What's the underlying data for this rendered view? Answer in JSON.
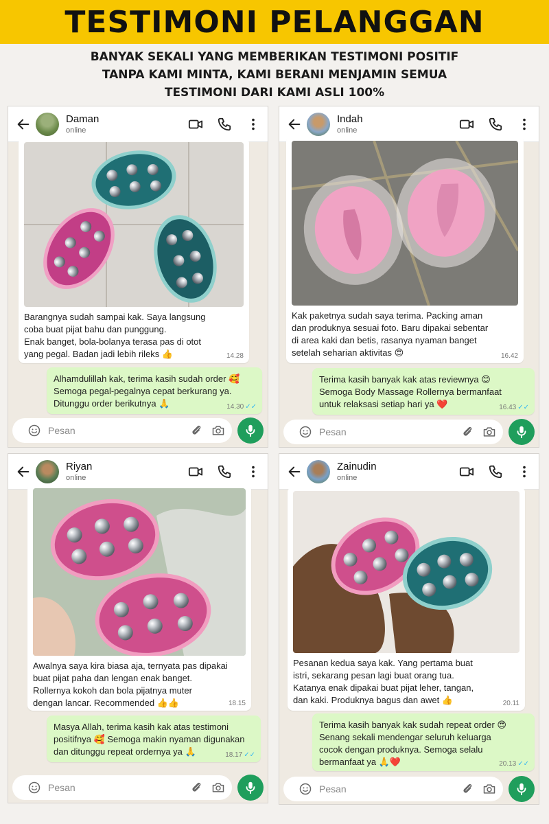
{
  "banner": {
    "title": "TESTIMONI PELANGGAN"
  },
  "subtitle": {
    "line1": "BANYAK SEKALI YANG MEMBERIKAN TESTIMONI POSITIF",
    "line2": "TANPA KAMI MINTA, KAMI BERANI MENJAMIN SEMUA",
    "line3": "TESTIMONI DARI KAMI ASLI 100%"
  },
  "colors": {
    "banner": "#f7c600",
    "outgoing_bubble": "#dcf8c6",
    "chat_bg": "#efeae2",
    "mic_button": "#1f9e5c",
    "read_ticks": "#34b7f1"
  },
  "icons": {
    "back": "arrow-left-icon",
    "video": "video-call-icon",
    "call": "phone-icon",
    "menu": "more-vert-icon",
    "emoji": "emoji-icon",
    "attach": "paperclip-icon",
    "camera": "camera-icon",
    "mic": "mic-icon"
  },
  "composer_placeholder": "Pesan",
  "chats": [
    {
      "name": "Daman",
      "status": "online",
      "incoming": {
        "line1": "Barangnya sudah sampai kak. Saya langsung",
        "line2": "coba buat pijat bahu dan punggung.",
        "line3": "Enak banget, bola-bolanya terasa pas di otot",
        "line4": "yang pegal. Badan jadi lebih rileks 👍",
        "time": "14.28"
      },
      "reply": {
        "line1": "Alhamdulillah kak, terima kasih sudah order 🥰",
        "line2": "Semoga pegal-pegalnya cepat berkurang ya.",
        "line3": "Ditunggu order berikutnya 🙏",
        "time": "14.30"
      }
    },
    {
      "name": "Indah",
      "status": "online",
      "incoming": {
        "line1": "Kak paketnya sudah saya terima. Packing aman",
        "line2": "dan produknya sesuai foto. Baru dipakai sebentar",
        "line3": "di area kaki dan betis, rasanya nyaman banget",
        "line4": "setelah seharian aktivitas 😍",
        "time": "16.42"
      },
      "reply": {
        "line1": "Terima kasih banyak kak atas reviewnya 😊",
        "line2": "Semoga Body Massage Rollernya bermanfaat",
        "line3": "untuk relaksasi setiap hari ya ❤️",
        "time": "16.43"
      }
    },
    {
      "name": "Riyan",
      "status": "online",
      "incoming": {
        "line1": "Awalnya saya kira biasa aja, ternyata pas dipakai",
        "line2": "buat pijat paha dan lengan enak banget.",
        "line3": "Rollernya kokoh dan bola pijatnya muter",
        "line4": "dengan lancar. Recommended 👍👍",
        "time": "18.15"
      },
      "reply": {
        "line1": "Masya Allah, terima kasih kak atas testimoni",
        "line2": "positifnya 🥰 Semoga makin nyaman digunakan",
        "line3": "dan ditunggu repeat ordernya ya 🙏",
        "time": "18.17"
      }
    },
    {
      "name": "Zainudin",
      "status": "online",
      "incoming": {
        "line1": "Pesanan kedua saya kak. Yang pertama buat",
        "line2": "istri, sekarang pesan lagi buat orang tua.",
        "line3": "Katanya enak dipakai buat pijat leher, tangan,",
        "line4": "dan kaki. Produknya bagus dan awet 👍",
        "time": "20.11"
      },
      "reply": {
        "line1": "Terima kasih banyak kak sudah repeat order 😍",
        "line2": "Senang sekali mendengar seluruh keluarga",
        "line3": "cocok dengan produknya. Semoga selalu",
        "line4": "bermanfaat ya 🙏❤️",
        "time": "20.13"
      }
    }
  ]
}
